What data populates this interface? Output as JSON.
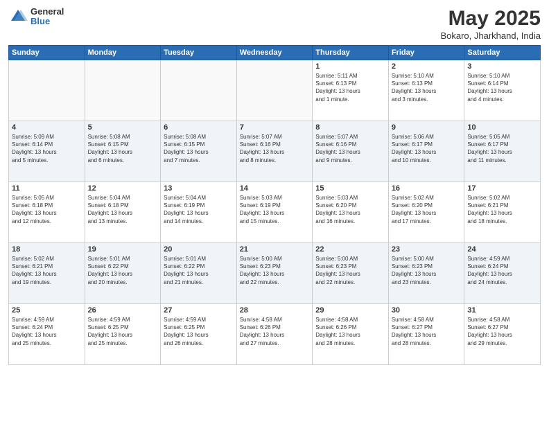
{
  "header": {
    "logo_general": "General",
    "logo_blue": "Blue",
    "title": "May 2025",
    "subtitle": "Bokaro, Jharkhand, India"
  },
  "weekdays": [
    "Sunday",
    "Monday",
    "Tuesday",
    "Wednesday",
    "Thursday",
    "Friday",
    "Saturday"
  ],
  "weeks": [
    [
      {
        "day": "",
        "info": ""
      },
      {
        "day": "",
        "info": ""
      },
      {
        "day": "",
        "info": ""
      },
      {
        "day": "",
        "info": ""
      },
      {
        "day": "1",
        "info": "Sunrise: 5:11 AM\nSunset: 6:13 PM\nDaylight: 13 hours\nand 1 minute."
      },
      {
        "day": "2",
        "info": "Sunrise: 5:10 AM\nSunset: 6:13 PM\nDaylight: 13 hours\nand 3 minutes."
      },
      {
        "day": "3",
        "info": "Sunrise: 5:10 AM\nSunset: 6:14 PM\nDaylight: 13 hours\nand 4 minutes."
      }
    ],
    [
      {
        "day": "4",
        "info": "Sunrise: 5:09 AM\nSunset: 6:14 PM\nDaylight: 13 hours\nand 5 minutes."
      },
      {
        "day": "5",
        "info": "Sunrise: 5:08 AM\nSunset: 6:15 PM\nDaylight: 13 hours\nand 6 minutes."
      },
      {
        "day": "6",
        "info": "Sunrise: 5:08 AM\nSunset: 6:15 PM\nDaylight: 13 hours\nand 7 minutes."
      },
      {
        "day": "7",
        "info": "Sunrise: 5:07 AM\nSunset: 6:16 PM\nDaylight: 13 hours\nand 8 minutes."
      },
      {
        "day": "8",
        "info": "Sunrise: 5:07 AM\nSunset: 6:16 PM\nDaylight: 13 hours\nand 9 minutes."
      },
      {
        "day": "9",
        "info": "Sunrise: 5:06 AM\nSunset: 6:17 PM\nDaylight: 13 hours\nand 10 minutes."
      },
      {
        "day": "10",
        "info": "Sunrise: 5:05 AM\nSunset: 6:17 PM\nDaylight: 13 hours\nand 11 minutes."
      }
    ],
    [
      {
        "day": "11",
        "info": "Sunrise: 5:05 AM\nSunset: 6:18 PM\nDaylight: 13 hours\nand 12 minutes."
      },
      {
        "day": "12",
        "info": "Sunrise: 5:04 AM\nSunset: 6:18 PM\nDaylight: 13 hours\nand 13 minutes."
      },
      {
        "day": "13",
        "info": "Sunrise: 5:04 AM\nSunset: 6:19 PM\nDaylight: 13 hours\nand 14 minutes."
      },
      {
        "day": "14",
        "info": "Sunrise: 5:03 AM\nSunset: 6:19 PM\nDaylight: 13 hours\nand 15 minutes."
      },
      {
        "day": "15",
        "info": "Sunrise: 5:03 AM\nSunset: 6:20 PM\nDaylight: 13 hours\nand 16 minutes."
      },
      {
        "day": "16",
        "info": "Sunrise: 5:02 AM\nSunset: 6:20 PM\nDaylight: 13 hours\nand 17 minutes."
      },
      {
        "day": "17",
        "info": "Sunrise: 5:02 AM\nSunset: 6:21 PM\nDaylight: 13 hours\nand 18 minutes."
      }
    ],
    [
      {
        "day": "18",
        "info": "Sunrise: 5:02 AM\nSunset: 6:21 PM\nDaylight: 13 hours\nand 19 minutes."
      },
      {
        "day": "19",
        "info": "Sunrise: 5:01 AM\nSunset: 6:22 PM\nDaylight: 13 hours\nand 20 minutes."
      },
      {
        "day": "20",
        "info": "Sunrise: 5:01 AM\nSunset: 6:22 PM\nDaylight: 13 hours\nand 21 minutes."
      },
      {
        "day": "21",
        "info": "Sunrise: 5:00 AM\nSunset: 6:23 PM\nDaylight: 13 hours\nand 22 minutes."
      },
      {
        "day": "22",
        "info": "Sunrise: 5:00 AM\nSunset: 6:23 PM\nDaylight: 13 hours\nand 22 minutes."
      },
      {
        "day": "23",
        "info": "Sunrise: 5:00 AM\nSunset: 6:23 PM\nDaylight: 13 hours\nand 23 minutes."
      },
      {
        "day": "24",
        "info": "Sunrise: 4:59 AM\nSunset: 6:24 PM\nDaylight: 13 hours\nand 24 minutes."
      }
    ],
    [
      {
        "day": "25",
        "info": "Sunrise: 4:59 AM\nSunset: 6:24 PM\nDaylight: 13 hours\nand 25 minutes."
      },
      {
        "day": "26",
        "info": "Sunrise: 4:59 AM\nSunset: 6:25 PM\nDaylight: 13 hours\nand 25 minutes."
      },
      {
        "day": "27",
        "info": "Sunrise: 4:59 AM\nSunset: 6:25 PM\nDaylight: 13 hours\nand 26 minutes."
      },
      {
        "day": "28",
        "info": "Sunrise: 4:58 AM\nSunset: 6:26 PM\nDaylight: 13 hours\nand 27 minutes."
      },
      {
        "day": "29",
        "info": "Sunrise: 4:58 AM\nSunset: 6:26 PM\nDaylight: 13 hours\nand 28 minutes."
      },
      {
        "day": "30",
        "info": "Sunrise: 4:58 AM\nSunset: 6:27 PM\nDaylight: 13 hours\nand 28 minutes."
      },
      {
        "day": "31",
        "info": "Sunrise: 4:58 AM\nSunset: 6:27 PM\nDaylight: 13 hours\nand 29 minutes."
      }
    ]
  ]
}
